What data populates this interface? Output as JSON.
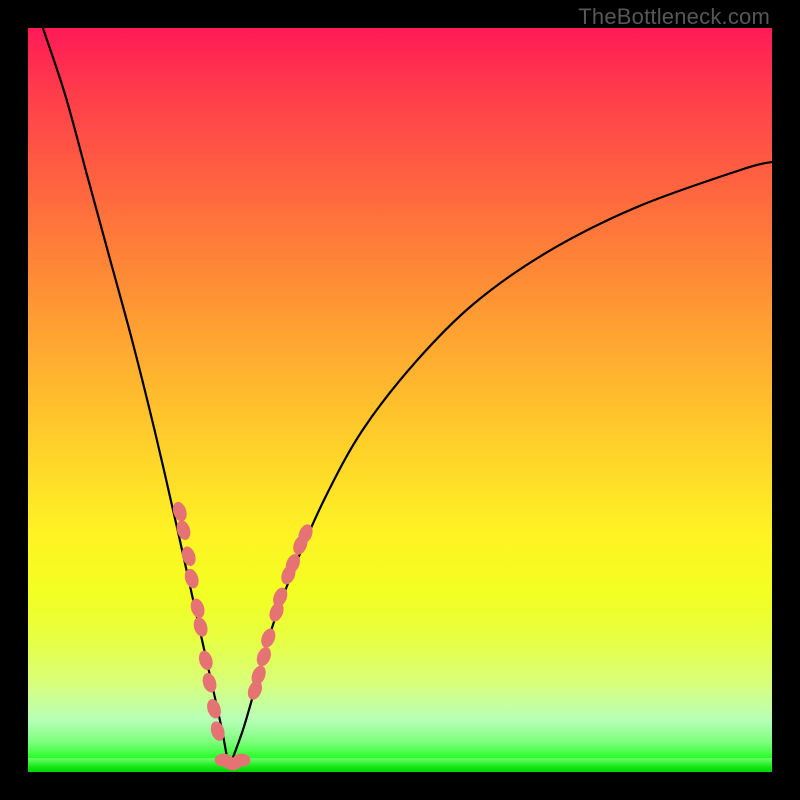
{
  "attribution": "TheBottleneck.com",
  "colors": {
    "frame": "#000000",
    "curve": "#000000",
    "bead": "#e57373",
    "gradient_top": "#ff1a56",
    "gradient_bottom": "#00e800"
  },
  "chart_data": {
    "type": "line",
    "title": "",
    "xlabel": "",
    "ylabel": "",
    "xlim": [
      0,
      100
    ],
    "ylim": [
      0,
      100
    ],
    "notes": "Bottleneck-style V curve on rainbow heatmap background. y maps color: high y = red (bad), low y = green (good). Left branch falls steeply from off-chart top-left to a trough near x≈27, right branch rises with decreasing slope toward upper right. Salmon beads cluster on both branches near the bottom of the V.",
    "series": [
      {
        "name": "left_branch",
        "x": [
          2,
          5,
          8,
          11,
          14,
          17,
          20,
          22,
          24,
          26,
          27
        ],
        "y": [
          100,
          91,
          80,
          69,
          58,
          46,
          33,
          24,
          15,
          6,
          0.5
        ]
      },
      {
        "name": "right_branch",
        "x": [
          27,
          29,
          31,
          33,
          36,
          40,
          45,
          52,
          60,
          70,
          82,
          96,
          100
        ],
        "y": [
          0.5,
          6,
          13,
          20,
          28,
          37,
          46,
          55,
          63,
          70,
          76,
          81,
          82
        ]
      }
    ],
    "beads_left": [
      [
        20.4,
        35
      ],
      [
        20.9,
        32.5
      ],
      [
        21.6,
        29
      ],
      [
        22.0,
        26
      ],
      [
        22.8,
        22
      ],
      [
        23.2,
        19.5
      ],
      [
        23.9,
        15
      ],
      [
        24.4,
        12
      ],
      [
        25.0,
        8.5
      ],
      [
        25.5,
        5.5
      ]
    ],
    "beads_right": [
      [
        30.5,
        11
      ],
      [
        31.0,
        13
      ],
      [
        31.7,
        15.5
      ],
      [
        32.3,
        18
      ],
      [
        33.4,
        21.5
      ],
      [
        33.9,
        23.5
      ],
      [
        35.0,
        26.5
      ],
      [
        35.6,
        28
      ],
      [
        36.6,
        30.5
      ],
      [
        37.3,
        32
      ]
    ],
    "beads_bottom": [
      [
        26.3,
        1.6
      ],
      [
        27.5,
        1.1
      ],
      [
        28.7,
        1.6
      ]
    ]
  }
}
